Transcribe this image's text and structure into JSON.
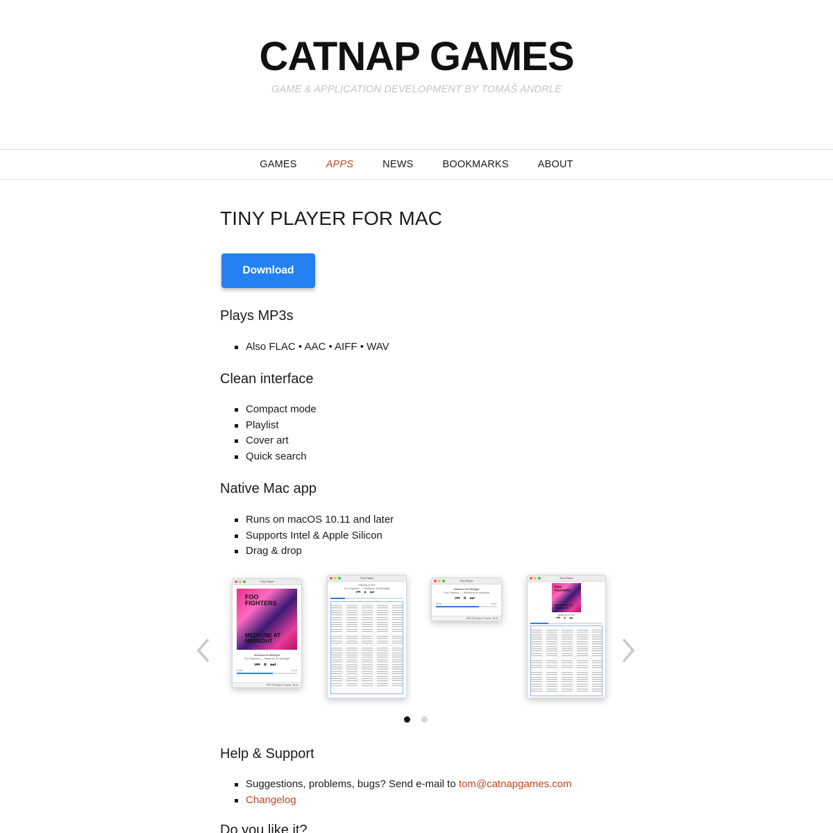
{
  "site": {
    "title": "CATNAP GAMES",
    "tagline": "GAME & APPLICATION DEVELOPMENT BY TOMÁŠ ANDRLE"
  },
  "nav": {
    "items": [
      {
        "label": "GAMES"
      },
      {
        "label": "APPS"
      },
      {
        "label": "NEWS"
      },
      {
        "label": "BOOKMARKS"
      },
      {
        "label": "ABOUT"
      }
    ],
    "active": "APPS"
  },
  "page": {
    "title": "TINY PLAYER FOR MAC",
    "download_label": "Download",
    "sections": [
      {
        "heading": "Plays MP3s",
        "items": [
          "Also FLAC • AAC • AIFF • WAV"
        ]
      },
      {
        "heading": "Clean interface",
        "items": [
          "Compact mode",
          "Playlist",
          "Cover art",
          "Quick search"
        ]
      },
      {
        "heading": "Native Mac app",
        "items": [
          "Runs on macOS 10.11 and later",
          "Supports Intel & Apple Silicon",
          "Drag & drop"
        ]
      }
    ],
    "support": {
      "heading": "Help & Support",
      "line1_text": "Suggestions, problems, bugs? Send e-mail to ",
      "email": "tom@catnapgames.com",
      "changelog": "Changelog"
    },
    "next_heading": "Do you like it?"
  },
  "carousel": {
    "shots": [
      {
        "window_title": "Tiny Player",
        "cover_text_top": "FOO FIGHTERS",
        "cover_text_bottom": "MEDICINE AT MIDNIGHT",
        "track": "Medicine At Midnight",
        "artist_album": "Foo Fighters — Medicine At Midnight",
        "time_elapsed": "2:16",
        "time_remaining": "-1:12",
        "status": "MP3 320 kbps  9 tracks, 36:31"
      },
      {
        "window_title": "Tiny Player",
        "track": "Making A Fire",
        "artist_album": "Foo Fighters — Medicine At Midnight"
      },
      {
        "window_title": "Tiny Player",
        "track": "Medicine At Midnight",
        "artist_album": "Foo Fighters — Medicine At Midnight",
        "time_elapsed": "3:01",
        "time_remaining": "-0:47",
        "status": "MP3 320 kbps  9 tracks, 36:31"
      },
      {
        "window_title": "Tiny Player",
        "track": "Making A Fire",
        "cover_text_top": "FOO FIGHTERS",
        "cover_text_bottom": "MEDICINE AT MIDNIGHT"
      }
    ],
    "prev_icon": "chevron-left-icon",
    "next_icon": "chevron-right-icon",
    "page_count": 2,
    "active_page": 1
  },
  "colors": {
    "accent": "#c0451e",
    "button": "#2381f2",
    "tagline": "#c4c4c4"
  }
}
